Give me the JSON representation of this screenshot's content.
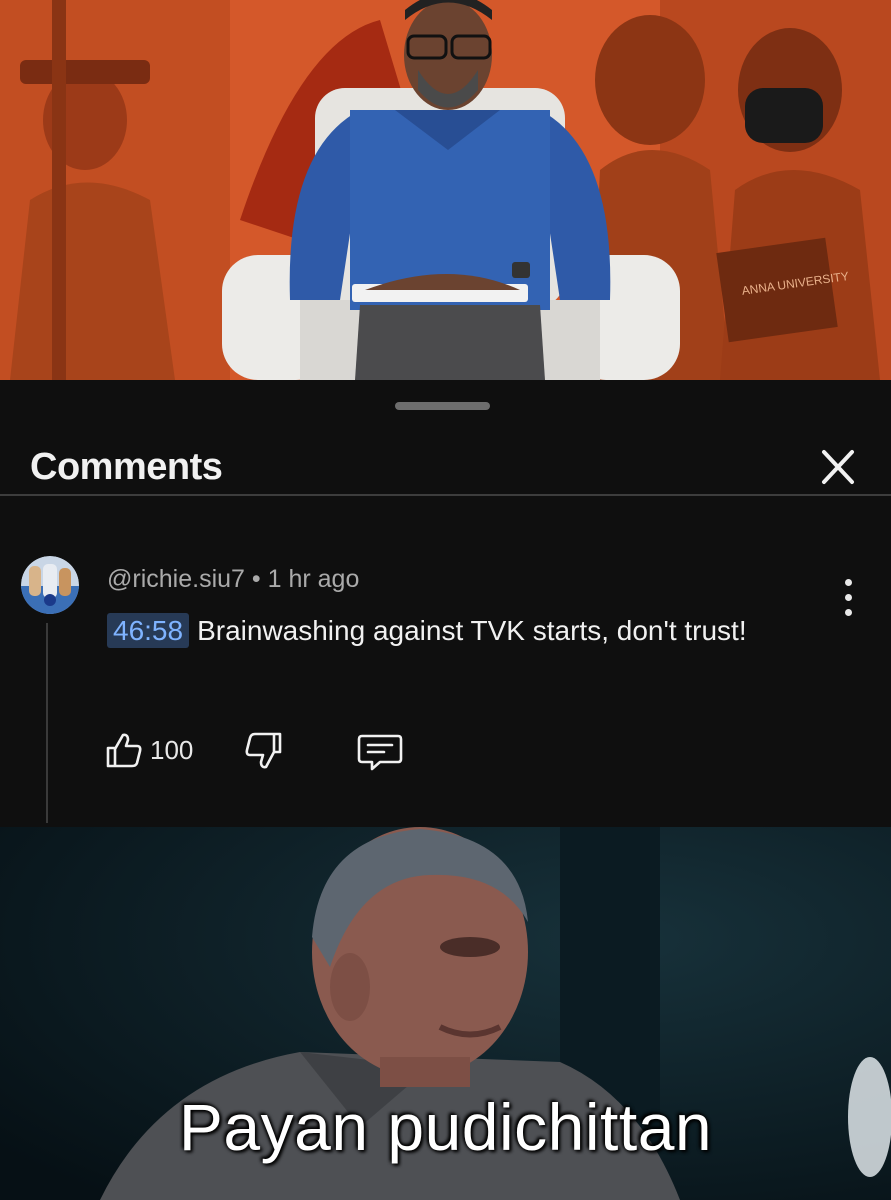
{
  "video": {
    "book_label": "ANNA UNIVERSITY"
  },
  "comments_sheet": {
    "title": "Comments",
    "close_icon": "close-icon"
  },
  "comment": {
    "username": "@richie.siu7",
    "separator": "•",
    "time_ago": "1 hr ago",
    "timestamp_link": "46:58",
    "text": "Brainwashing against TVK starts, don't trust!",
    "like_count": "100",
    "icons": {
      "like": "thumbs-up-icon",
      "dislike": "thumbs-down-icon",
      "reply": "reply-comment-icon",
      "menu": "more-vertical-icon"
    }
  },
  "meme": {
    "caption": "Payan pudichittan"
  },
  "colors": {
    "background": "#0f0f0f",
    "timestamp_bg": "#273a56",
    "timestamp_fg": "#7fb3ff",
    "video_orange": "#e0652a"
  }
}
